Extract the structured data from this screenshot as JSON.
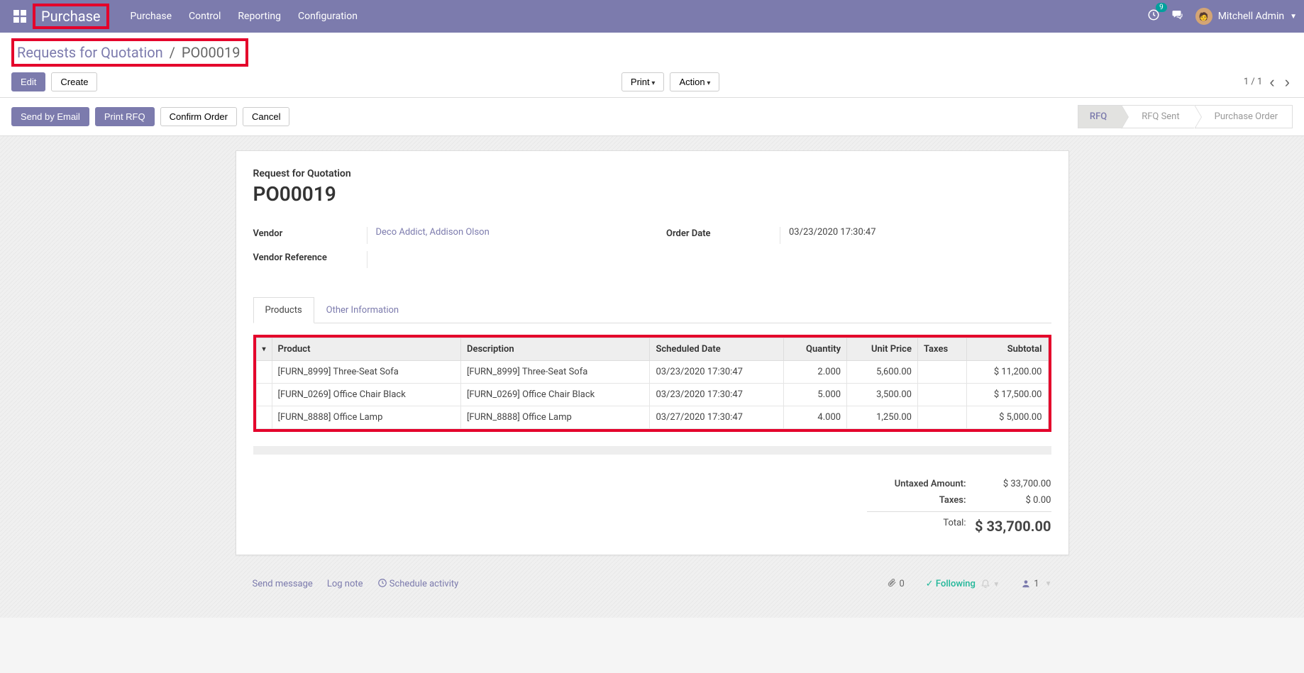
{
  "nav": {
    "brand": "Purchase",
    "menu": [
      "Purchase",
      "Control",
      "Reporting",
      "Configuration"
    ],
    "notification_count": "9",
    "user": "Mitchell Admin"
  },
  "breadcrumb": {
    "parent": "Requests for Quotation",
    "current": "PO00019"
  },
  "buttons": {
    "edit": "Edit",
    "create": "Create",
    "print": "Print",
    "action": "Action"
  },
  "pager": "1 / 1",
  "status_buttons": {
    "send_email": "Send by Email",
    "print_rfq": "Print RFQ",
    "confirm": "Confirm Order",
    "cancel": "Cancel"
  },
  "statusbar": {
    "rfq": "RFQ",
    "rfq_sent": "RFQ Sent",
    "po": "Purchase Order"
  },
  "form": {
    "subtitle": "Request for Quotation",
    "title": "PO00019",
    "labels": {
      "vendor": "Vendor",
      "vendor_ref": "Vendor Reference",
      "order_date": "Order Date"
    },
    "values": {
      "vendor": "Deco Addict, Addison Olson",
      "vendor_ref": "",
      "order_date": "03/23/2020 17:30:47"
    }
  },
  "tabs": {
    "products": "Products",
    "other": "Other Information"
  },
  "table": {
    "headers": {
      "product": "Product",
      "description": "Description",
      "scheduled_date": "Scheduled Date",
      "quantity": "Quantity",
      "unit_price": "Unit Price",
      "taxes": "Taxes",
      "subtotal": "Subtotal"
    },
    "rows": [
      {
        "product": "[FURN_8999] Three-Seat Sofa",
        "description": "[FURN_8999] Three-Seat Sofa",
        "scheduled_date": "03/23/2020 17:30:47",
        "quantity": "2.000",
        "unit_price": "5,600.00",
        "taxes": "",
        "subtotal": "$ 11,200.00"
      },
      {
        "product": "[FURN_0269] Office Chair Black",
        "description": "[FURN_0269] Office Chair Black",
        "scheduled_date": "03/23/2020 17:30:47",
        "quantity": "5.000",
        "unit_price": "3,500.00",
        "taxes": "",
        "subtotal": "$ 17,500.00"
      },
      {
        "product": "[FURN_8888] Office Lamp",
        "description": "[FURN_8888] Office Lamp",
        "scheduled_date": "03/27/2020 17:30:47",
        "quantity": "4.000",
        "unit_price": "1,250.00",
        "taxes": "",
        "subtotal": "$ 5,000.00"
      }
    ]
  },
  "totals": {
    "untaxed_label": "Untaxed Amount:",
    "untaxed_value": "$ 33,700.00",
    "taxes_label": "Taxes:",
    "taxes_value": "$ 0.00",
    "total_label": "Total:",
    "total_value": "$ 33,700.00"
  },
  "chatter": {
    "send": "Send message",
    "log": "Log note",
    "schedule": "Schedule activity",
    "attachments": "0",
    "following": "Following",
    "followers": "1"
  }
}
